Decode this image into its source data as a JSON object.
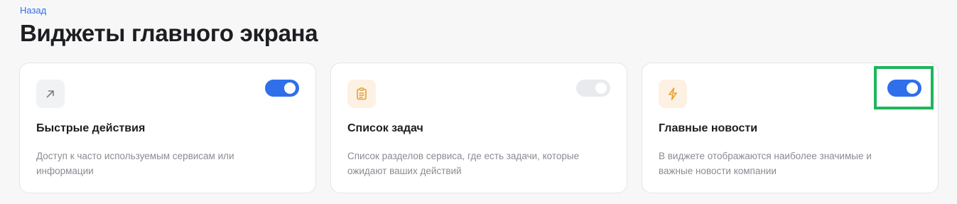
{
  "nav": {
    "back_label": "Назад"
  },
  "page": {
    "title": "Виджеты главного экрана"
  },
  "widgets": [
    {
      "icon": "arrow-up-right-icon",
      "title": "Быстрые действия",
      "description": "Доступ к часто используемым сервисам или информации",
      "enabled": true
    },
    {
      "icon": "clipboard-list-icon",
      "title": "Список задач",
      "description": "Список разделов сервиса, где есть задачи, которые ожидают ваших действий",
      "enabled": false
    },
    {
      "icon": "lightning-icon",
      "title": "Главные новости",
      "description": "В виджете отображаются наиболее значимые и важные новости компании",
      "enabled": true
    }
  ],
  "colors": {
    "accent": "#2f6fea",
    "toggle_off": "#e9eaed",
    "icon_orange": "#e8a030",
    "highlight": "#1eb65a"
  }
}
